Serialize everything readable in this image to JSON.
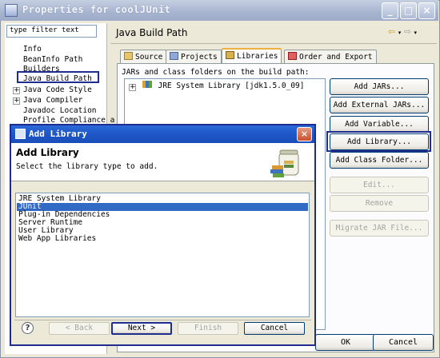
{
  "window": {
    "title": "Properties for coolJUnit"
  },
  "sidebar": {
    "filter_placeholder": "type filter text",
    "items": [
      {
        "label": "Info",
        "expandable": false
      },
      {
        "label": "BeanInfo Path",
        "expandable": false
      },
      {
        "label": "Builders",
        "expandable": false
      },
      {
        "label": "Java Build Path",
        "expandable": false,
        "selected": true
      },
      {
        "label": "Java Code Style",
        "expandable": true
      },
      {
        "label": "Java Compiler",
        "expandable": true
      },
      {
        "label": "Javadoc Location",
        "expandable": false
      },
      {
        "label": "Profile Compliance a",
        "expandable": false
      }
    ]
  },
  "page": {
    "title": "Java Build Path",
    "tabs": [
      {
        "label": "Source",
        "active": false
      },
      {
        "label": "Projects",
        "active": false
      },
      {
        "label": "Libraries",
        "active": true
      },
      {
        "label": "Order and Export",
        "active": false
      }
    ],
    "jars_label": "JARs and class folders on the build path:",
    "tree": [
      {
        "label": "JRE System Library [jdk1.5.0_09]",
        "expander": "+"
      }
    ],
    "buttons": {
      "add_jars": "Add JARs...",
      "add_external_jars": "Add External JARs...",
      "add_variable": "Add Variable...",
      "add_library": "Add Library...",
      "add_class_folder": "Add Class Folder...",
      "edit": "Edit...",
      "remove": "Remove",
      "migrate_jar": "Migrate JAR File..."
    },
    "footer": {
      "ok": "OK",
      "cancel": "Cancel"
    }
  },
  "dialog": {
    "title": "Add Library",
    "heading": "Add Library",
    "subtitle": "Select the library type to add.",
    "library_types": [
      {
        "label": "JRE System Library",
        "selected": false
      },
      {
        "label": "JUnit",
        "selected": true
      },
      {
        "label": "Plug-in Dependencies",
        "selected": false
      },
      {
        "label": "Server Runtime",
        "selected": false
      },
      {
        "label": "User Library",
        "selected": false
      },
      {
        "label": "Web App Libraries",
        "selected": false
      }
    ],
    "buttons": {
      "back": "< Back",
      "next": "Next >",
      "finish": "Finish",
      "cancel": "Cancel"
    },
    "help_glyph": "?"
  },
  "colors": {
    "selection": "#316ac5",
    "dialog_titlebar": "#1d55c6",
    "highlight_box": "#1f2d8f",
    "window_face": "#ece9d8"
  }
}
